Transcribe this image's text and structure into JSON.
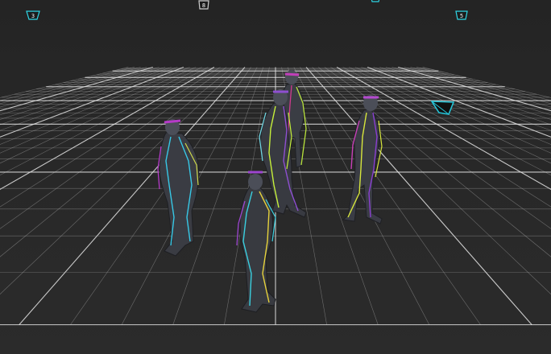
{
  "viewport": {
    "background": "#262626",
    "grid_color": "#bdbdbd",
    "grid_major_color": "#e6e6e6"
  },
  "cameras": [
    {
      "id": "cam-1",
      "label": "3",
      "icon": "camera-icon",
      "color": "#2fd6e6"
    },
    {
      "id": "cam-2",
      "label": "8",
      "icon": "camera-icon",
      "color": "#cfcfcf"
    },
    {
      "id": "cam-3",
      "label": "",
      "icon": "camera-icon",
      "color": "#2fd6e6"
    },
    {
      "id": "cam-4",
      "label": "5",
      "icon": "camera-icon",
      "color": "#2fd6e6"
    },
    {
      "id": "cam-5",
      "label": "",
      "icon": "camera-frustum-icon",
      "color": "#25c3d6"
    }
  ],
  "actors": [
    {
      "id": "actor-back-center",
      "icon": "skeleton-figure",
      "bone_colors": [
        "#d13a8f",
        "#b8e23c",
        "#8a44c8"
      ]
    },
    {
      "id": "actor-mid-center",
      "icon": "skeleton-figure",
      "bone_colors": [
        "#c6f03a",
        "#8e4fd0",
        "#6fd3e0"
      ]
    },
    {
      "id": "actor-left",
      "icon": "skeleton-figure",
      "bone_colors": [
        "#37c8e6",
        "#b53ac8",
        "#cfd94a"
      ]
    },
    {
      "id": "actor-right",
      "icon": "skeleton-figure",
      "bone_colors": [
        "#d7e63c",
        "#8a3fd1",
        "#c840b8"
      ]
    },
    {
      "id": "actor-front",
      "icon": "skeleton-figure",
      "bone_colors": [
        "#3ad0e0",
        "#e6d23c",
        "#9d45d0"
      ]
    }
  ]
}
